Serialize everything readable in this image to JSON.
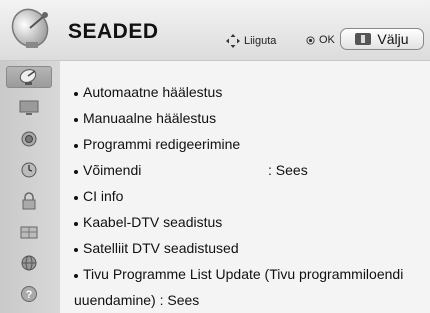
{
  "header": {
    "title": "SEADED",
    "nav_label": "Liiguta",
    "ok_label": "OK",
    "exit_label": "Välju"
  },
  "sidebar": {
    "items": [
      {
        "icon": "satellite-dish-icon",
        "active": true
      },
      {
        "icon": "tv-screen-icon",
        "active": false
      },
      {
        "icon": "speaker-icon",
        "active": false
      },
      {
        "icon": "clock-icon",
        "active": false
      },
      {
        "icon": "lock-icon",
        "active": false
      },
      {
        "icon": "options-box-icon",
        "active": false
      },
      {
        "icon": "network-globe-icon",
        "active": false
      },
      {
        "icon": "help-icon",
        "active": false
      }
    ]
  },
  "menu": {
    "items": [
      {
        "label": "Automaatne häälestus"
      },
      {
        "label": "Manuaalne häälestus"
      },
      {
        "label": "Programmi redigeerimine"
      },
      {
        "label": "Võimendi",
        "value": ": Sees"
      },
      {
        "label": "CI info"
      },
      {
        "label": "Kaabel-DTV seadistus"
      },
      {
        "label": "Satelliit DTV seadistused"
      },
      {
        "label": "Tivu Programme List Update (Tivu programmiloendi"
      },
      {
        "label": "uuendamine) : Sees"
      }
    ]
  }
}
